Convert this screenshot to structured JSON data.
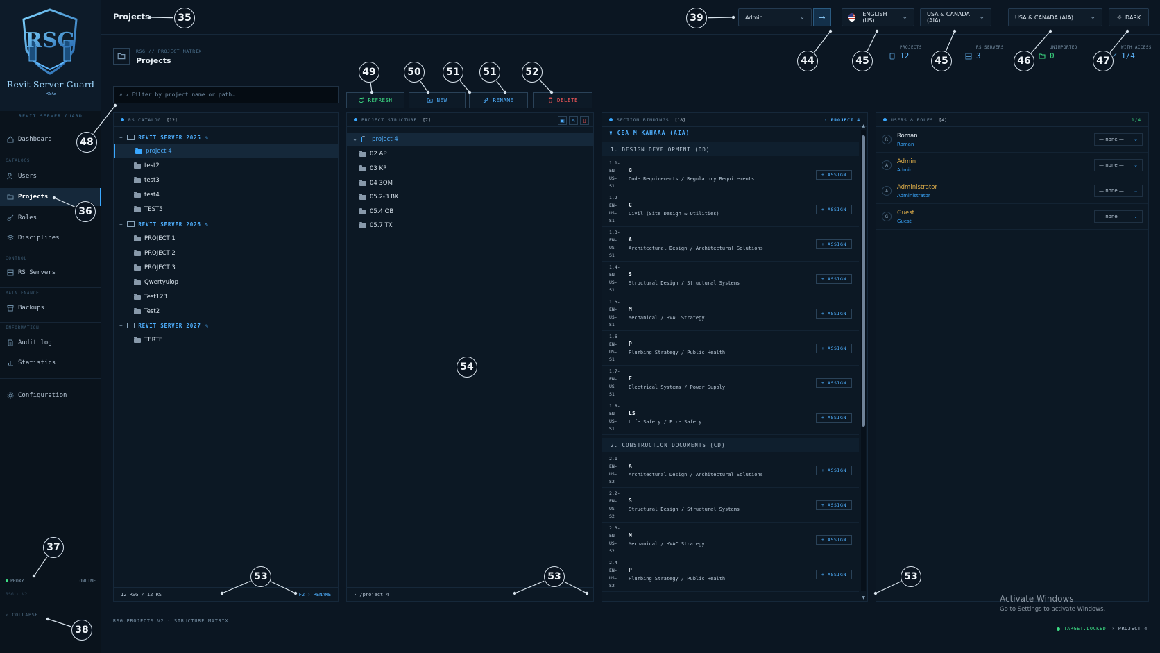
{
  "brand": {
    "title": "Revit Server Guard",
    "sub": "RSG",
    "caption": "REVIT SERVER GUARD"
  },
  "nav": {
    "sections": {
      "catalogs": "CATALOGS",
      "control": "CONTROL",
      "maintenance": "MAINTENANCE",
      "information": "INFORMATION"
    },
    "items": [
      "Dashboard",
      "Users",
      "Projects",
      "Roles",
      "Disciplines",
      "RS Servers",
      "Backups",
      "Audit log",
      "Statistics",
      "Configuration"
    ]
  },
  "proxy": {
    "label": "PROXY",
    "status": "ONLINE",
    "sub": "RSG · V2"
  },
  "collapse": "‹ COLLAPSE",
  "topbar": {
    "title": "Projects",
    "user_select": "Admin",
    "language": "ENGLISH (US)",
    "region1": "USA & CANADA (AIA)",
    "region2": "USA & CANADA (AIA)",
    "theme": "DARK"
  },
  "header": {
    "crumb": "RSG // PROJECT MATRIX",
    "title": "Projects"
  },
  "stats": [
    {
      "label": "PROJECTS",
      "value": "12"
    },
    {
      "label": "RS SERVERS",
      "value": "3"
    },
    {
      "label": "UNIMPORTED",
      "value": "0"
    },
    {
      "label": "WITH ACCESS",
      "value": "1/4"
    }
  ],
  "filter": {
    "placeholder": "Filter by project name or path…"
  },
  "actions": {
    "refresh": "REFRESH",
    "new": "NEW",
    "rename": "RENAME",
    "delete": "DELETE"
  },
  "catalog": {
    "title": "RS CATALOG",
    "count": "[12]",
    "servers": [
      {
        "name": "REVIT SERVER 2025",
        "projects": [
          "project 4",
          "test2",
          "test3",
          "test4",
          "TEST5"
        ]
      },
      {
        "name": "REVIT SERVER 2026",
        "projects": [
          "PROJECT 1",
          "PROJECT 2",
          "PROJECT 3",
          "Qwertyuiop",
          "Test123",
          "Test2"
        ]
      },
      {
        "name": "REVIT SERVER 2027",
        "projects": [
          "TERTE"
        ]
      }
    ],
    "footer_left": "12 RSG / 12 RS",
    "footer_right": "F2 › RENAME"
  },
  "structure": {
    "title": "PROJECT STRUCTURE",
    "count": "[7]",
    "root": "project 4",
    "items": [
      "02 AP",
      "03 KP",
      "04 3OM",
      "05.2-3 BK",
      "05.4 OB",
      "05.7 TX"
    ],
    "footer": "› /project 4"
  },
  "bindings": {
    "title": "SECTION BINDINGS",
    "count": "[18]",
    "context": "› PROJECT 4",
    "standard": "∨ CEA M KAHAAA (AIA)",
    "assign_label": "+ ASSIGN",
    "groups": [
      {
        "title": "1. DESIGN DEVELOPMENT (DD)",
        "rows": [
          {
            "code": [
              "1.1-",
              "EN-US-",
              "S1"
            ],
            "letter": "G",
            "name": "Code Requirements / Regulatory Requirements"
          },
          {
            "code": [
              "1.2-",
              "EN-US-",
              "S1"
            ],
            "letter": "C",
            "name": "Civil (Site Design & Utilities)"
          },
          {
            "code": [
              "1.3-",
              "EN-US-",
              "S1"
            ],
            "letter": "A",
            "name": "Architectural Design / Architectural Solutions"
          },
          {
            "code": [
              "1.4-",
              "EN-US-",
              "S1"
            ],
            "letter": "S",
            "name": "Structural Design / Structural Systems"
          },
          {
            "code": [
              "1.5-",
              "EN-US-",
              "S1"
            ],
            "letter": "M",
            "name": "Mechanical / HVAC Strategy"
          },
          {
            "code": [
              "1.6-",
              "EN-US-",
              "S1"
            ],
            "letter": "P",
            "name": "Plumbing Strategy / Public Health"
          },
          {
            "code": [
              "1.7-",
              "EN-US-",
              "S1"
            ],
            "letter": "E",
            "name": "Electrical Systems / Power Supply"
          },
          {
            "code": [
              "1.8-",
              "EN-US-",
              "S1"
            ],
            "letter": "LS",
            "name": "Life Safety / Fire Safety"
          }
        ]
      },
      {
        "title": "2. CONSTRUCTION DOCUMENTS (CD)",
        "rows": [
          {
            "code": [
              "2.1-",
              "EN-US-",
              "S2"
            ],
            "letter": "A",
            "name": "Architectural Design / Architectural Solutions"
          },
          {
            "code": [
              "2.2-",
              "EN-US-",
              "S2"
            ],
            "letter": "S",
            "name": "Structural Design / Structural Systems"
          },
          {
            "code": [
              "2.3-",
              "EN-US-",
              "S2"
            ],
            "letter": "M",
            "name": "Mechanical / HVAC Strategy"
          },
          {
            "code": [
              "2.4-",
              "EN-US-",
              "S2"
            ],
            "letter": "P",
            "name": "Plumbing Strategy / Public Health"
          }
        ]
      }
    ]
  },
  "users": {
    "title": "USERS & ROLES",
    "count": "[4]",
    "ratio": "1/4",
    "list": [
      {
        "initial": "R",
        "name": "Roman",
        "sub": "Roman",
        "role": "— none —",
        "color": "#e6eef5"
      },
      {
        "initial": "A",
        "name": "Admin",
        "sub": "Admin",
        "role": "— none —",
        "color": "#e2b04a"
      },
      {
        "initial": "A",
        "name": "Administrator",
        "sub": "Administrator",
        "role": "— none —",
        "color": "#e2b04a"
      },
      {
        "initial": "G",
        "name": "Guest",
        "sub": "Guest",
        "role": "— none —",
        "color": "#e2b04a"
      }
    ]
  },
  "bottom": {
    "caption": "RSG.PROJECTS.V2 · STRUCTURE MATRIX",
    "status_ok": "TARGET.LOCKED",
    "status_ctx": "› PROJECT 4"
  },
  "watermark": {
    "line1": "Activate Windows",
    "line2": "Go to Settings to activate Windows."
  },
  "callouts": [
    "35",
    "36",
    "37",
    "38",
    "39",
    "44",
    "45",
    "45",
    "46",
    "47",
    "48",
    "49",
    "50",
    "51",
    "51",
    "52",
    "53",
    "53",
    "53",
    "54"
  ],
  "colors": {
    "accent": "#3aa8ff",
    "ok": "#3ddc84",
    "danger": "#ff5a5a",
    "warn": "#e2b04a"
  }
}
